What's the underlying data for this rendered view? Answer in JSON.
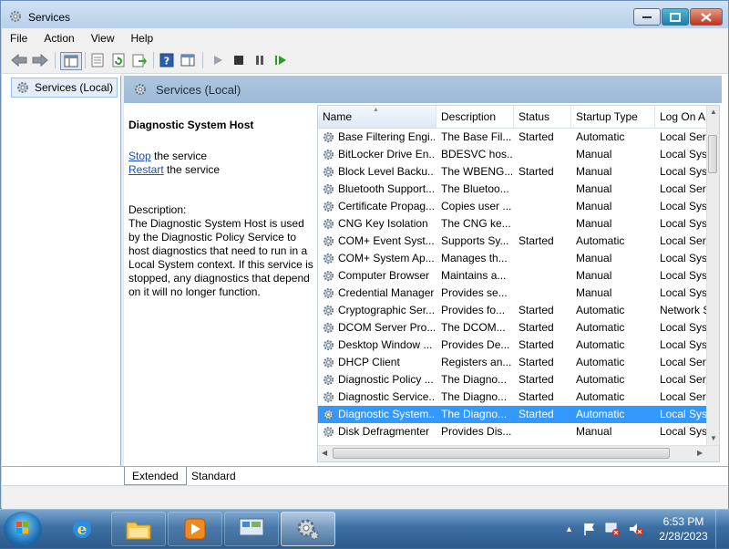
{
  "window": {
    "title": "Services"
  },
  "menu": [
    "File",
    "Action",
    "View",
    "Help"
  ],
  "tree": {
    "label": "Services (Local)"
  },
  "pane_header": "Services (Local)",
  "description_panel": {
    "service_name": "Diagnostic System Host",
    "stop_link": "Stop",
    "stop_suffix": " the service",
    "restart_link": "Restart",
    "restart_suffix": " the service",
    "description_label": "Description:",
    "description_text": "The Diagnostic System Host is used by the Diagnostic Policy Service to host diagnostics that need to run in a Local System context.  If this service is stopped, any diagnostics that depend on it will no longer function."
  },
  "columns": [
    "Name",
    "Description",
    "Status",
    "Startup Type",
    "Log On A"
  ],
  "rows": [
    {
      "name": "Base Filtering Engi...",
      "description": "The Base Fil...",
      "status": "Started",
      "startup": "Automatic",
      "logon": "Local Serv"
    },
    {
      "name": "BitLocker Drive En...",
      "description": "BDESVC hos...",
      "status": "",
      "startup": "Manual",
      "logon": "Local Syst"
    },
    {
      "name": "Block Level Backu...",
      "description": "The WBENG...",
      "status": "Started",
      "startup": "Manual",
      "logon": "Local Syst"
    },
    {
      "name": "Bluetooth Support...",
      "description": "The Bluetoo...",
      "status": "",
      "startup": "Manual",
      "logon": "Local Serv"
    },
    {
      "name": "Certificate Propag...",
      "description": "Copies user ...",
      "status": "",
      "startup": "Manual",
      "logon": "Local Syst"
    },
    {
      "name": "CNG Key Isolation",
      "description": "The CNG ke...",
      "status": "",
      "startup": "Manual",
      "logon": "Local Syst"
    },
    {
      "name": "COM+ Event Syst...",
      "description": "Supports Sy...",
      "status": "Started",
      "startup": "Automatic",
      "logon": "Local Serv"
    },
    {
      "name": "COM+ System Ap...",
      "description": "Manages th...",
      "status": "",
      "startup": "Manual",
      "logon": "Local Syst"
    },
    {
      "name": "Computer Browser",
      "description": "Maintains a...",
      "status": "",
      "startup": "Manual",
      "logon": "Local Syst"
    },
    {
      "name": "Credential Manager",
      "description": "Provides se...",
      "status": "",
      "startup": "Manual",
      "logon": "Local Syst"
    },
    {
      "name": "Cryptographic Ser...",
      "description": "Provides fo...",
      "status": "Started",
      "startup": "Automatic",
      "logon": "Network S"
    },
    {
      "name": "DCOM Server Pro...",
      "description": "The DCOM...",
      "status": "Started",
      "startup": "Automatic",
      "logon": "Local Syst"
    },
    {
      "name": "Desktop Window ...",
      "description": "Provides De...",
      "status": "Started",
      "startup": "Automatic",
      "logon": "Local Syst"
    },
    {
      "name": "DHCP Client",
      "description": "Registers an...",
      "status": "Started",
      "startup": "Automatic",
      "logon": "Local Serv"
    },
    {
      "name": "Diagnostic Policy ...",
      "description": "The Diagno...",
      "status": "Started",
      "startup": "Automatic",
      "logon": "Local Serv"
    },
    {
      "name": "Diagnostic Service...",
      "description": "The Diagno...",
      "status": "Started",
      "startup": "Automatic",
      "logon": "Local Serv"
    },
    {
      "name": "Diagnostic System...",
      "description": "The Diagno...",
      "status": "Started",
      "startup": "Automatic",
      "logon": "Local Syst",
      "selected": true
    },
    {
      "name": "Disk Defragmenter",
      "description": "Provides Dis...",
      "status": "",
      "startup": "Manual",
      "logon": "Local Syst"
    }
  ],
  "tabs": [
    "Extended",
    "Standard"
  ],
  "clock": {
    "time": "6:53 PM",
    "date": "2/28/2023"
  },
  "colors": {
    "selection": "#3399ff",
    "header": "#9ebad8",
    "link": "#1b4fb3"
  }
}
